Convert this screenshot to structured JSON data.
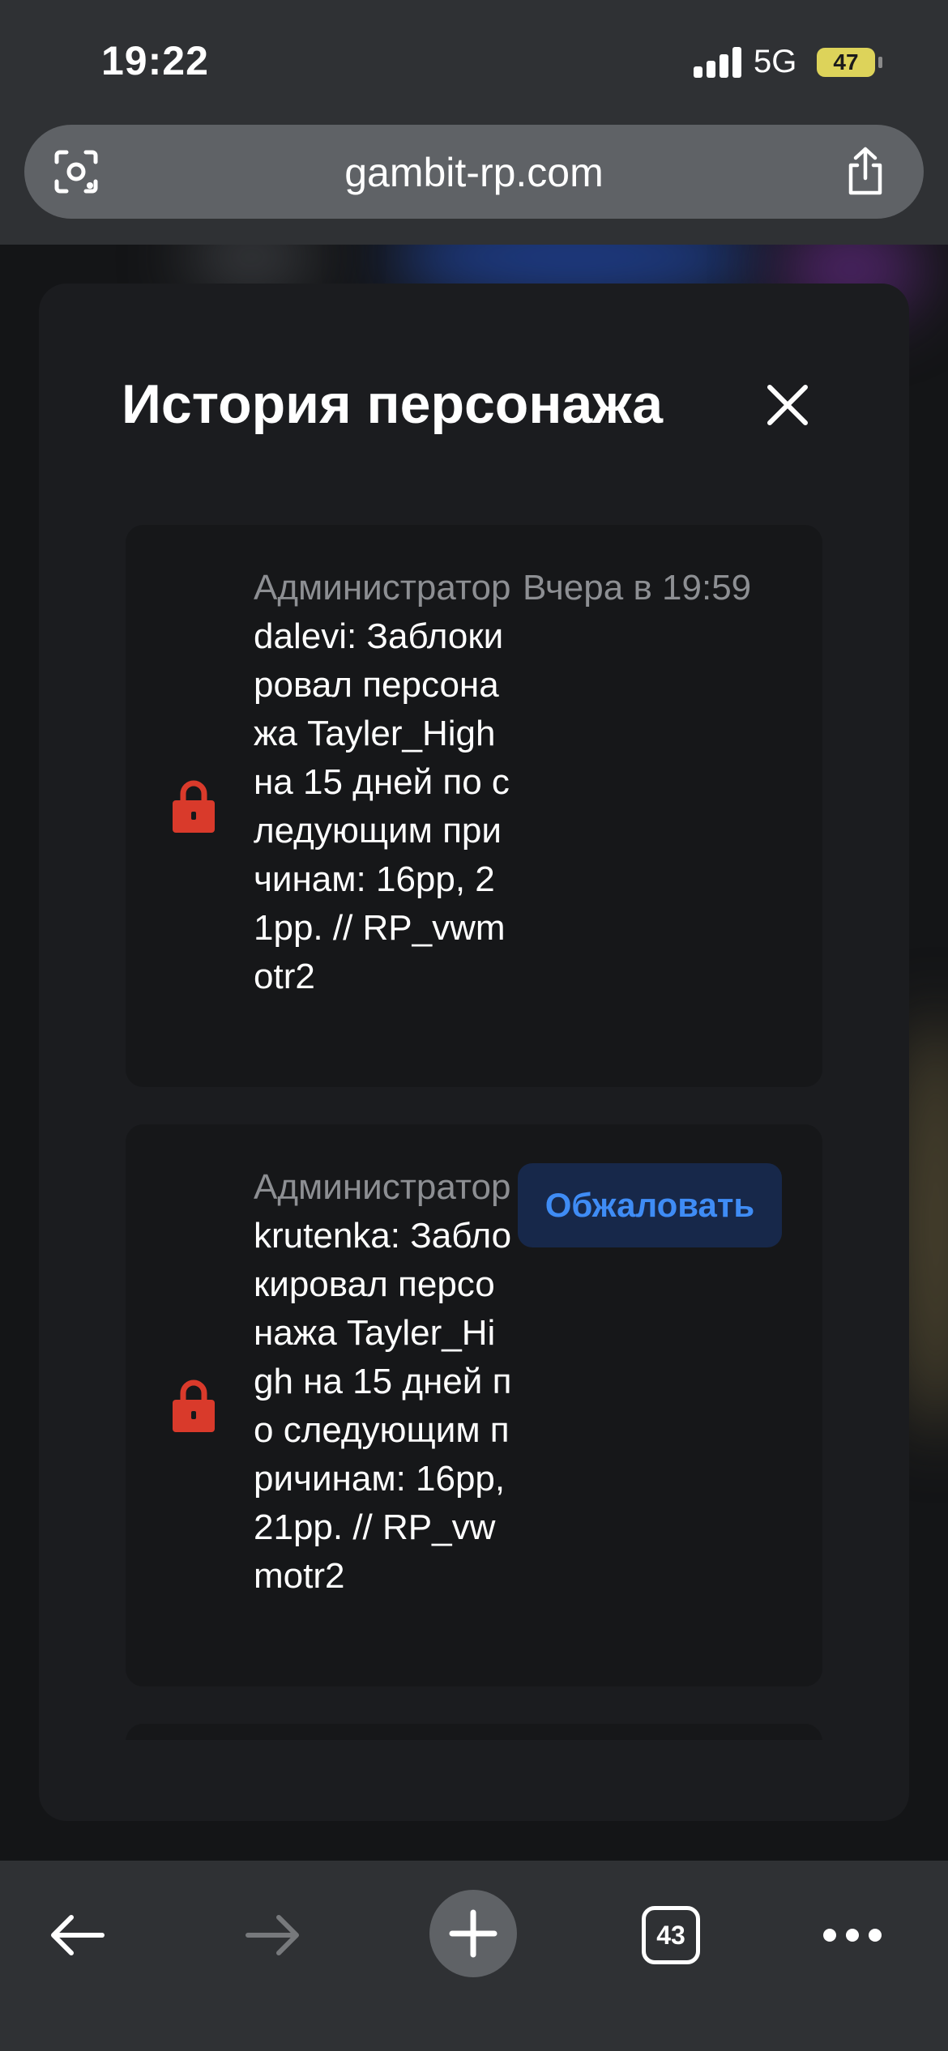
{
  "status_bar": {
    "time": "19:22",
    "network": "5G",
    "battery": "47",
    "icons": [
      "signal-icon",
      "battery-charging-icon"
    ]
  },
  "browser": {
    "url": "gambit-rp.com",
    "icons": [
      "lens-icon",
      "share-icon"
    ]
  },
  "modal": {
    "title": "История персонажа",
    "close_icon": "close-icon",
    "entries": [
      {
        "icon": "lock-icon",
        "role_prefix": "Администратор",
        "admin": "dalevi",
        "message": "Заблокировал персонажа Tayler_High на 15 дней по следующим причинам: 16рр, 21рр. // RP_vwmotr2",
        "time": "Вчера в 19:59"
      },
      {
        "icon": "lock-icon",
        "role_prefix": "Администратор",
        "admin": "krutenka",
        "message": "Заблокировал персонажа Tayler_High на 15 дней по следующим причинам: 16рр, 21рр. // RP_vwmotr2",
        "action_label": "Обжаловать"
      }
    ]
  },
  "toolbar": {
    "tab_count": "43",
    "icons": [
      "back-arrow-icon",
      "forward-arrow-icon",
      "plus-icon",
      "tabs-icon",
      "more-icon"
    ]
  },
  "colors": {
    "lock": "#d93a2b",
    "link_blue": "#3f8cf5",
    "muted_text": "#8d8f93",
    "battery": "#ddd35a"
  }
}
